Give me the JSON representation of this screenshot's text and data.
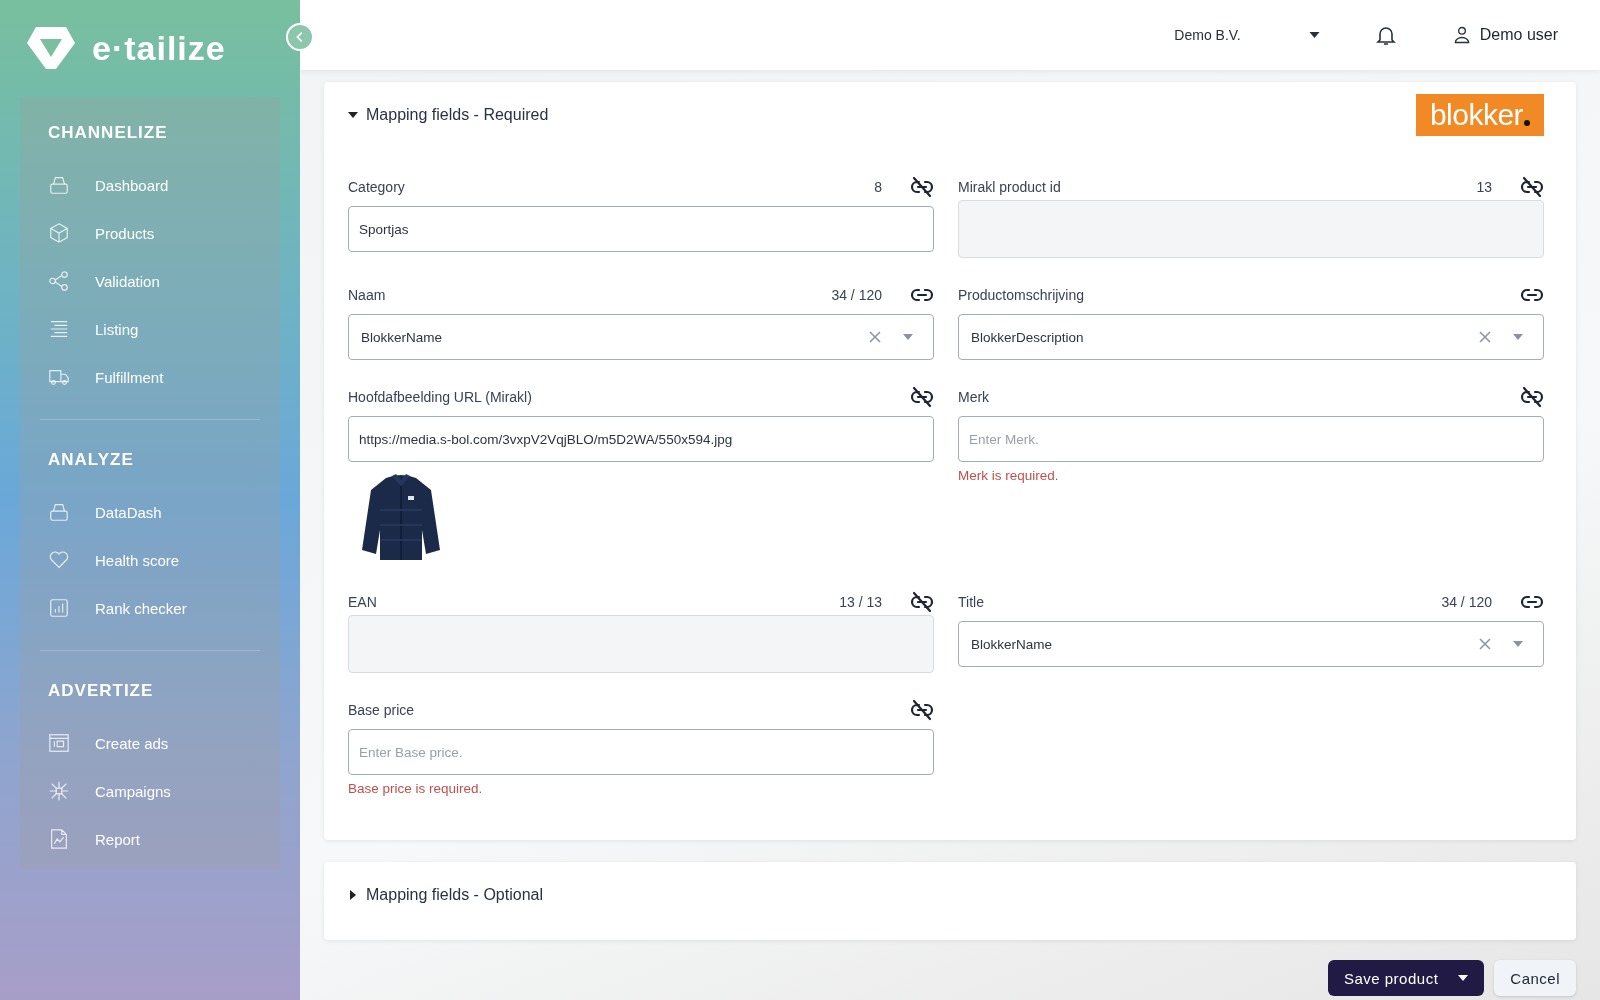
{
  "brand": {
    "name": "e·tailize"
  },
  "header": {
    "company": "Demo B.V.",
    "user": "Demo user"
  },
  "sidebar": {
    "sections": [
      {
        "title": "CHANNELIZE",
        "items": [
          {
            "label": "Dashboard",
            "kind": "dashboard"
          },
          {
            "label": "Products",
            "kind": "products"
          },
          {
            "label": "Validation",
            "kind": "validation"
          },
          {
            "label": "Listing",
            "kind": "listing"
          },
          {
            "label": "Fulfillment",
            "kind": "fulfillment"
          }
        ]
      },
      {
        "title": "ANALYZE",
        "items": [
          {
            "label": "DataDash",
            "kind": "dashboard"
          },
          {
            "label": "Health score",
            "kind": "health"
          },
          {
            "label": "Rank checker",
            "kind": "rank"
          }
        ]
      },
      {
        "title": "ADVERTIZE",
        "items": [
          {
            "label": "Create ads",
            "kind": "ads"
          },
          {
            "label": "Campaigns",
            "kind": "campaigns"
          },
          {
            "label": "Report",
            "kind": "report"
          }
        ]
      }
    ]
  },
  "sections": [
    {
      "title": "Mapping fields - Required",
      "expanded": true,
      "marketplace_logo": "blokker",
      "fields": [
        {
          "label": "Category",
          "counter": "8",
          "linked": false,
          "kind": "text",
          "value": "Sportjas"
        },
        {
          "label": "Mirakl product id",
          "counter": "13",
          "linked": false,
          "kind": "readonly"
        },
        {
          "label": "Naam",
          "counter": "34 / 120",
          "linked": true,
          "kind": "select",
          "value": "BlokkerName"
        },
        {
          "label": "Productomschrijving",
          "linked": true,
          "kind": "select",
          "value": "BlokkerDescription"
        },
        {
          "label": "Hoofdafbeelding URL (Mirakl)",
          "linked": false,
          "kind": "text",
          "value": "https://media.s-bol.com/3vxpV2VqjBLO/m5D2WA/550x594.jpg"
        },
        {
          "label": "Merk",
          "linked": false,
          "kind": "text",
          "placeholder": "Enter Merk.",
          "error": "Merk is required."
        },
        {
          "label": "EAN",
          "counter": "13 / 13",
          "linked": false,
          "kind": "readonly"
        },
        {
          "label": "Title",
          "counter": "34 / 120",
          "linked": true,
          "kind": "select",
          "value": "BlokkerName"
        },
        {
          "label": "Base price",
          "linked": false,
          "kind": "text",
          "placeholder": "Enter Base price.",
          "error": "Base price is required."
        }
      ]
    },
    {
      "title": "Mapping fields - Optional",
      "expanded": false
    }
  ],
  "footer": {
    "primary": "Save product",
    "secondary": "Cancel"
  }
}
